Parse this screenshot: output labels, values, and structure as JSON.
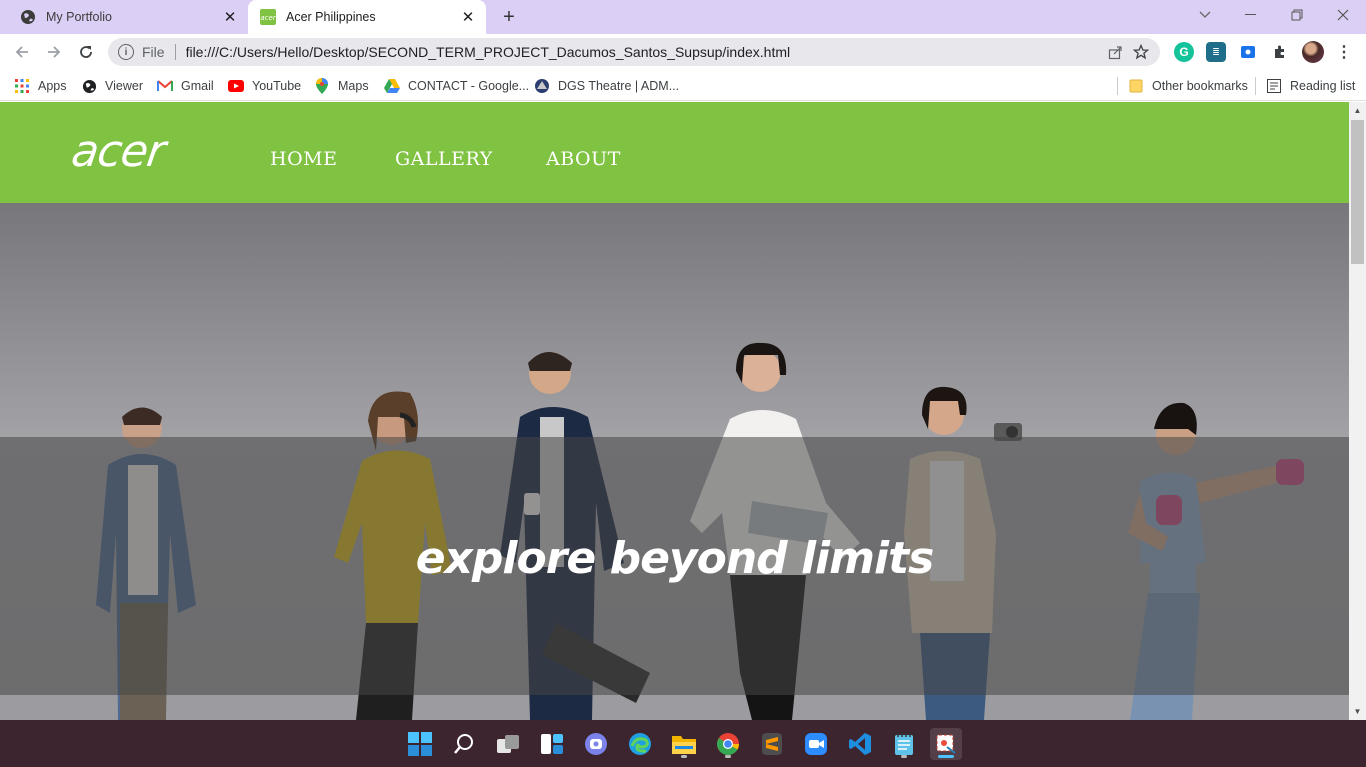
{
  "browser": {
    "tabs": [
      {
        "title": "My Portfolio",
        "icon": "globe-icon",
        "active": false
      },
      {
        "title": "Acer Philippines",
        "icon": "acer-favicon",
        "active": true
      }
    ],
    "new_tab": "+",
    "address": {
      "scheme_label": "File",
      "url": "file:///C:/Users/Hello/Desktop/SECOND_TERM_PROJECT_Dacumos_Santos_Supsup/index.html"
    },
    "bookmarks": [
      {
        "label": "Apps",
        "icon": "apps-grid-icon"
      },
      {
        "label": "Viewer",
        "icon": "globe-icon"
      },
      {
        "label": "Gmail",
        "icon": "gmail-icon"
      },
      {
        "label": "YouTube",
        "icon": "youtube-icon"
      },
      {
        "label": "Maps",
        "icon": "maps-icon"
      },
      {
        "label": "CONTACT - Google...",
        "icon": "google-drive-icon"
      },
      {
        "label": "DGS Theatre | ADM...",
        "icon": "dgs-icon"
      }
    ],
    "other_bookmarks": "Other bookmarks",
    "reading_list": "Reading list"
  },
  "site": {
    "logo_text": "acer",
    "nav": [
      "HOME",
      "GALLERY",
      "ABOUT"
    ],
    "hero_title": "explore beyond limits",
    "brand_color": "#80c242"
  },
  "taskbar": {
    "apps": [
      "windows-start-icon",
      "search-icon",
      "task-view-icon",
      "widgets-icon",
      "teams-chat-icon",
      "edge-icon",
      "file-explorer-icon",
      "chrome-icon",
      "sublime-text-icon",
      "zoom-icon",
      "vscode-icon",
      "notepad-icon",
      "snipping-tool-icon"
    ]
  }
}
